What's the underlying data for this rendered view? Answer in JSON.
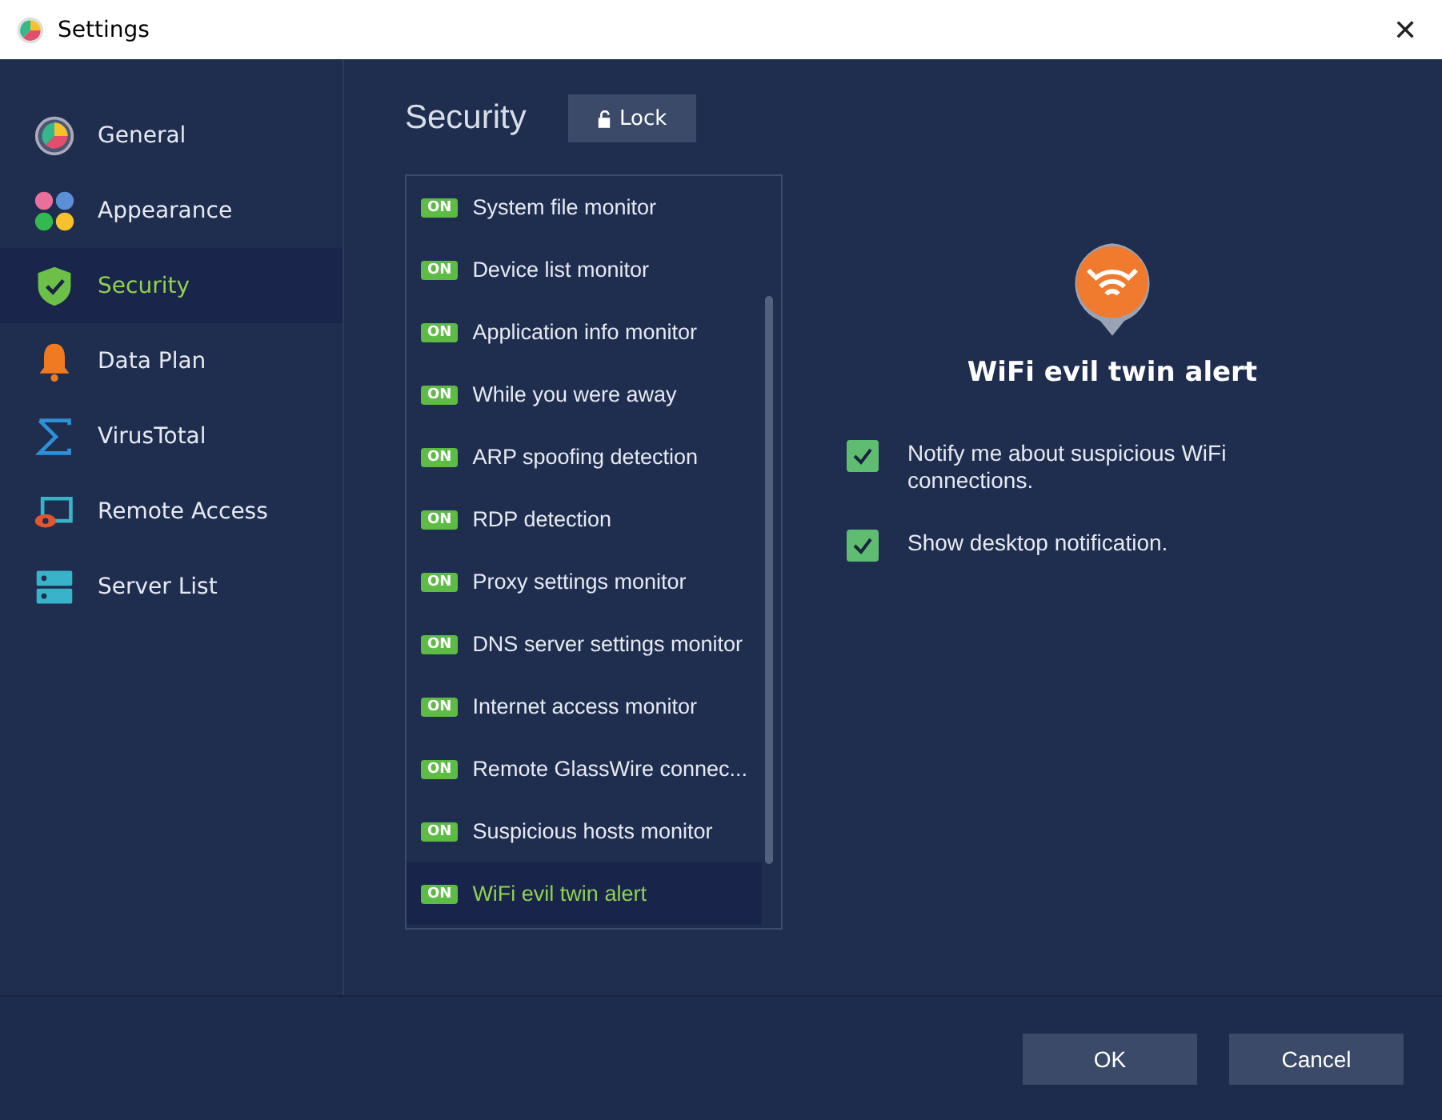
{
  "window": {
    "title": "Settings",
    "close": "✕"
  },
  "sidebar": {
    "items": [
      {
        "label": "General",
        "kind": "general",
        "selected": false
      },
      {
        "label": "Appearance",
        "kind": "appearance",
        "selected": false
      },
      {
        "label": "Security",
        "kind": "security",
        "selected": true
      },
      {
        "label": "Data Plan",
        "kind": "dataplan",
        "selected": false
      },
      {
        "label": "VirusTotal",
        "kind": "virustotal",
        "selected": false
      },
      {
        "label": "Remote Access",
        "kind": "remote",
        "selected": false
      },
      {
        "label": "Server List",
        "kind": "servers",
        "selected": false
      }
    ]
  },
  "page": {
    "title": "Security",
    "lock_button": "Lock"
  },
  "monitors": [
    {
      "toggle": "ON",
      "on": true,
      "label": "System file monitor",
      "selected": false
    },
    {
      "toggle": "ON",
      "on": true,
      "label": "Device list monitor",
      "selected": false
    },
    {
      "toggle": "ON",
      "on": true,
      "label": "Application info monitor",
      "selected": false
    },
    {
      "toggle": "ON",
      "on": true,
      "label": "While you were away",
      "selected": false
    },
    {
      "toggle": "ON",
      "on": true,
      "label": "ARP spoofing detection",
      "selected": false
    },
    {
      "toggle": "ON",
      "on": true,
      "label": "RDP detection",
      "selected": false
    },
    {
      "toggle": "ON",
      "on": true,
      "label": "Proxy settings monitor",
      "selected": false
    },
    {
      "toggle": "ON",
      "on": true,
      "label": "DNS server settings monitor",
      "selected": false
    },
    {
      "toggle": "ON",
      "on": true,
      "label": "Internet access monitor",
      "selected": false
    },
    {
      "toggle": "ON",
      "on": true,
      "label": "Remote GlassWire connec...",
      "selected": false
    },
    {
      "toggle": "ON",
      "on": true,
      "label": "Suspicious hosts monitor",
      "selected": false
    },
    {
      "toggle": "ON",
      "on": true,
      "label": "WiFi evil twin alert",
      "selected": true
    }
  ],
  "detail": {
    "title": "WiFi evil twin alert",
    "options": [
      {
        "label": "Notify me about suspicious WiFi connections.",
        "checked": true
      },
      {
        "label": "Show desktop notification.",
        "checked": true
      }
    ]
  },
  "buttons": [
    "OK",
    "Cancel"
  ]
}
